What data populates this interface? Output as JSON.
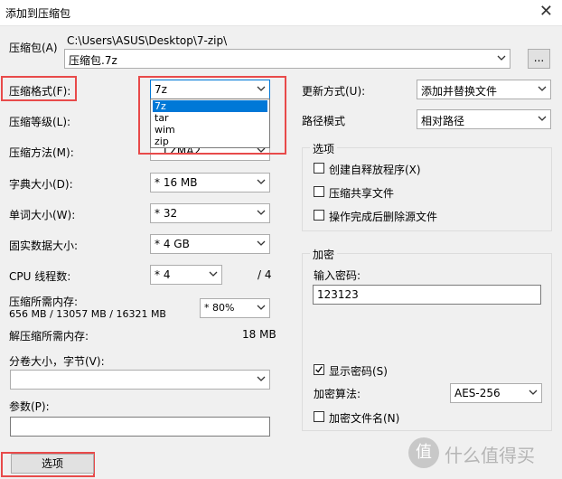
{
  "window": {
    "title": "添加到压缩包",
    "close": "✕"
  },
  "archive": {
    "label": "压缩包(A)",
    "path": "C:\\Users\\ASUS\\Desktop\\7-zip\\",
    "name": "压缩包.7z",
    "browse": "..."
  },
  "left": {
    "format": {
      "label": "压缩格式(F):",
      "value": "7z",
      "options": [
        "7z",
        "tar",
        "wim",
        "zip"
      ],
      "hidden_value": "LZMA2"
    },
    "level": {
      "label": "压缩等级(L):"
    },
    "method": {
      "label": "压缩方法(M):",
      "value": "LZMA2"
    },
    "dict": {
      "label": "字典大小(D):",
      "value": "* 16 MB"
    },
    "word": {
      "label": "单词大小(W):",
      "value": "* 32"
    },
    "solid": {
      "label": "固实数据大小:",
      "value": "* 4 GB"
    },
    "cpu": {
      "label": "CPU 线程数:",
      "value": "* 4",
      "max": "/ 4"
    },
    "mem": {
      "label": "压缩所需内存:",
      "detail": "656 MB / 13057 MB / 16321 MB",
      "value": "* 80%"
    },
    "decomp": {
      "label": "解压缩所需内存:",
      "value": "18 MB"
    },
    "split": {
      "label": "分卷大小，字节(V):",
      "value": ""
    },
    "params": {
      "label": "参数(P):",
      "value": ""
    },
    "options_button": "选项"
  },
  "right": {
    "update": {
      "label": "更新方式(U):",
      "value": "添加并替换文件"
    },
    "path_mode": {
      "label": "路径模式",
      "value": "相对路径"
    },
    "options_group": {
      "title": "选项",
      "items": [
        {
          "label": "创建自释放程序(X)",
          "checked": false
        },
        {
          "label": "压缩共享文件",
          "checked": false
        },
        {
          "label": "操作完成后删除源文件",
          "checked": false
        }
      ]
    },
    "encrypt_group": {
      "title": "加密",
      "password_label": "输入密码:",
      "password": "123123",
      "show_password": {
        "label": "显示密码(S)",
        "checked": true
      },
      "algo_label": "加密算法:",
      "algo": "AES-256",
      "encrypt_names": {
        "label": "加密文件名(N)",
        "checked": false
      }
    }
  },
  "watermark": {
    "text": "什么值得买",
    "logo": "值"
  },
  "colors": {
    "highlight": "#e84a4a",
    "selection": "#0078d7"
  }
}
